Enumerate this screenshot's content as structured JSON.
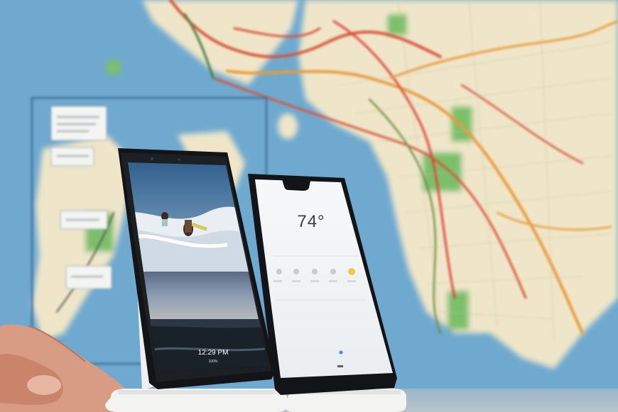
{
  "scene": {
    "background_map": "subway-map",
    "left_phone": {
      "wallpaper": "beach-surf-photo",
      "clock": "12:29 PM",
      "battery": "100%"
    },
    "right_phone": {
      "temperature": "74°"
    }
  },
  "colors": {
    "water": "#6fa9cf",
    "land": "#efe6c9",
    "route_red": "#d8553a",
    "route_orange": "#e99a3a",
    "park_green": "#7bbf6a",
    "stand_white": "#f3f3f1",
    "phone_black": "#121417"
  }
}
